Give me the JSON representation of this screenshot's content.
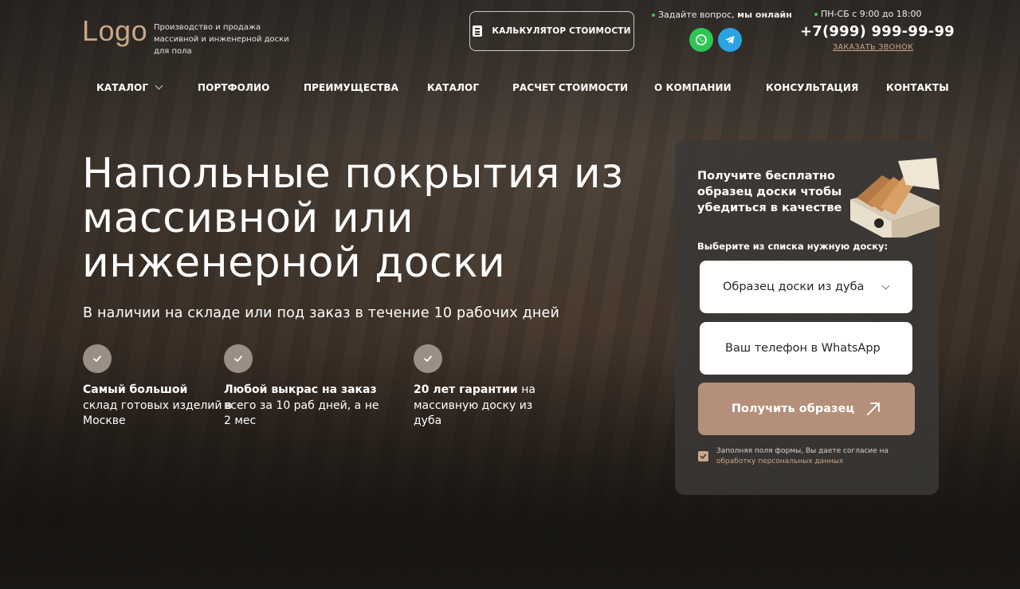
{
  "header": {
    "logo": "Logo",
    "tagline": "Производство и продажа массивной и инженерной доски для пола",
    "calc_button": "КАЛЬКУЛЯТОР СТОИМОСТИ",
    "ask_prefix": "Задайте вопрос,",
    "ask_online": "мы онлайн",
    "hours": "ПН-СБ с 9:00 до 18:00",
    "phone": "+7(999) 999-99-99",
    "callback": "ЗАКАЗАТЬ ЗВОНОК",
    "messengers": [
      {
        "name": "WhatsApp",
        "icon": "whatsapp-icon",
        "color": "#2fc553"
      },
      {
        "name": "Telegram",
        "icon": "telegram-icon",
        "color": "#2aa3e3"
      }
    ]
  },
  "nav": {
    "items": [
      {
        "label": "КАТАЛОГ"
      },
      {
        "label": "ПОРТФОЛИО"
      },
      {
        "label": "ПРЕИМУЩЕСТВА"
      },
      {
        "label": "КАТАЛОГ"
      },
      {
        "label": "РАСЧЕТ СТОИМОСТИ"
      },
      {
        "label": "О КОМПАНИИ"
      },
      {
        "label": "КОНСУЛЬТАЦИЯ"
      },
      {
        "label": "КОНТАКТЫ"
      }
    ]
  },
  "hero": {
    "title": "Напольные покрытия из массивной или инженерной доски",
    "subtitle": "В наличии на складе или под заказ в течение 10 рабочих дней",
    "features": [
      {
        "bold": "Самый большой",
        "text": "склад готовых изделий в Москве"
      },
      {
        "bold": "Любой выкрас на заказ",
        "text": "всего за 10 раб дней, а не 2 мес"
      },
      {
        "bold": "20 лет гарантии",
        "text": "на массивную доску из дуба"
      }
    ]
  },
  "form": {
    "title": "Получите бесплатно образец доски чтобы убедиться в качестве",
    "label": "Выберите из списка нужную доску:",
    "select_value": "Образец доски из дуба",
    "phone_placeholder": "Ваш телефон в WhatsApp",
    "submit": "Получить образец",
    "consent_text": "Заполняя поля формы, Вы даете согласие на",
    "consent_link": "обработку персональных данных",
    "accent_color": "#b4907a"
  }
}
